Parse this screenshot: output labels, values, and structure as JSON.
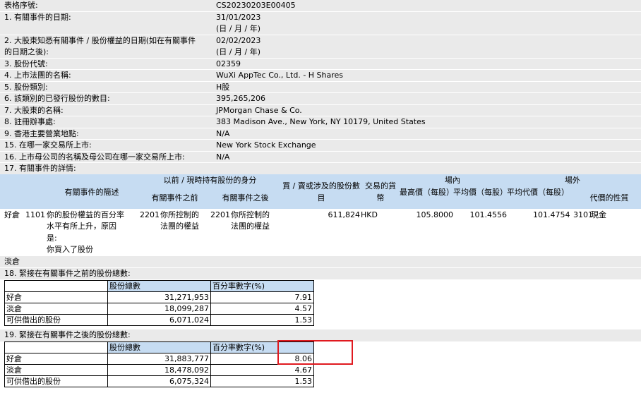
{
  "info_rows": [
    {
      "label": "表格序號:",
      "value": "CS20230203E00405"
    },
    {
      "label": "1. 有關事件的日期:",
      "value": "31/01/2023",
      "value2": "(日 / 月 / 年)"
    },
    {
      "label": "2. 大股東知悉有關事件 / 股份權益的日期(如在有關事件",
      "label2": "的日期之後):",
      "value": "02/02/2023",
      "value2": "(日 / 月 / 年)"
    },
    {
      "label": "3. 股份代號:",
      "value": "02359"
    },
    {
      "label": "4. 上市法團的名稱:",
      "value": "WuXi AppTec Co., Ltd. - H Shares"
    },
    {
      "label": "5. 股份類別:",
      "value": "H股"
    },
    {
      "label": "6. 該類別的已發行股份的數目:",
      "value": "395,265,206"
    },
    {
      "label": "7. 大股東的名稱:",
      "value": "JPMorgan Chase & Co."
    },
    {
      "label": "8. 註冊辦事處:",
      "value": "383 Madison Ave., New York, NY 10179, United States"
    },
    {
      "label": "9. 香港主要營業地點:",
      "value": "N/A"
    },
    {
      "label": "15. 在哪一家交易所上市:",
      "value": "New York Stock Exchange"
    },
    {
      "label": "16. 上市母公司的名稱及母公司在哪一家交易所上市:",
      "value": "N/A"
    },
    {
      "label": "17. 有關事件的詳情:",
      "value": ""
    }
  ],
  "event_table": {
    "headers": {
      "desc": "有關事件的簡述",
      "holding_group": "以前 / 現時持有股份的身分",
      "before": "有關事件之前",
      "after": "有關事件之後",
      "shares": "買 / 賣或涉及的股份數目",
      "currency": "交易的貨幣",
      "onmarket": "場內",
      "high": "最高價（每股）",
      "avg": "平均價（每股）",
      "offmarket": "場外",
      "avg_off": "平均代價（每股）",
      "nature": "代價的性質"
    },
    "row": {
      "position": "好倉",
      "code1": "1101",
      "desc_lines": [
        "你的股份權益的百分率",
        "水平有所上升，原因",
        "是:",
        "你買入了股份"
      ],
      "code2": "2201",
      "before_lines": [
        "你所控制的",
        "法團的權益"
      ],
      "code3": "2201",
      "after_lines": [
        "你所控制的",
        "法團的權益"
      ],
      "shares": "611,824",
      "currency": "HKD",
      "high": "105.8000",
      "avg": "101.4556",
      "avg_off": "101.4754",
      "code4": "3101",
      "nature": "現金"
    },
    "short_label": "淡倉"
  },
  "section18": {
    "title": "18. 緊接在有關事件之前的股份總數:",
    "col1": "股份總數",
    "col2": "百分率數字(%)",
    "rows": [
      {
        "label": "好倉",
        "shares": "31,271,953",
        "pct": "7.91"
      },
      {
        "label": "淡倉",
        "shares": "18,099,287",
        "pct": "4.57"
      },
      {
        "label": "可供借出的股份",
        "shares": "6,071,024",
        "pct": "1.53"
      }
    ]
  },
  "section19": {
    "title": "19. 緊接在有關事件之後的股份總數:",
    "col1": "股份總數",
    "col2": "百分率數字(%)",
    "rows": [
      {
        "label": "好倉",
        "shares": "31,883,777",
        "pct": "8.06"
      },
      {
        "label": "淡倉",
        "shares": "18,478,092",
        "pct": "4.67"
      },
      {
        "label": "可供借出的股份",
        "shares": "6,075,324",
        "pct": "1.53"
      }
    ]
  },
  "colors": {
    "shade": "#eaeaea",
    "header_blue": "#c6dcf2",
    "highlight_red": "#e0191f"
  }
}
